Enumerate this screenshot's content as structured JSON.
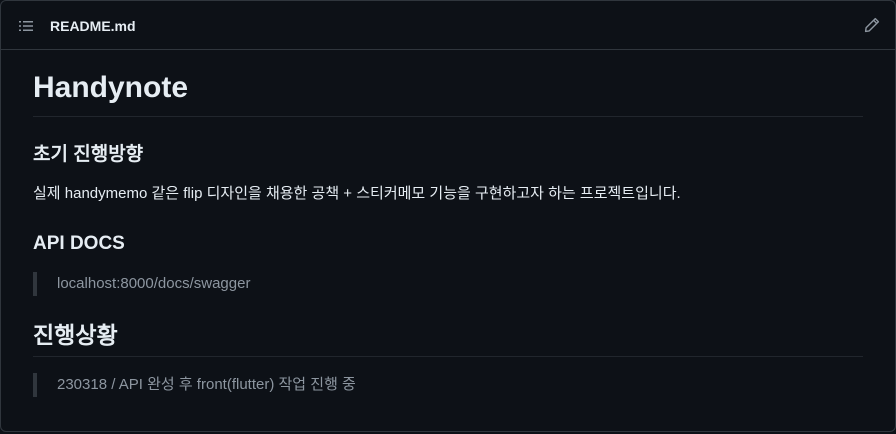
{
  "file": {
    "name": "README.md",
    "toc_icon": "list-icon",
    "edit_icon": "pencil-icon"
  },
  "readme": {
    "title": "Handynote",
    "section1_heading": "초기 진행방향",
    "section1_text": "실제 handymemo 같은 flip 디자인을 채용한 공책 + 스티커메모 기능을 구현하고자 하는 프로젝트입니다.",
    "section2_heading": "API DOCS",
    "section2_quote": "localhost:8000/docs/swagger",
    "section3_heading": "진행상황",
    "section3_quote": "230318 / API 완성 후 front(flutter) 작업 진행 중"
  },
  "colors": {
    "background": "#0d1117",
    "border": "#30363d",
    "text": "#e6edf3",
    "muted": "#8d96a0"
  }
}
